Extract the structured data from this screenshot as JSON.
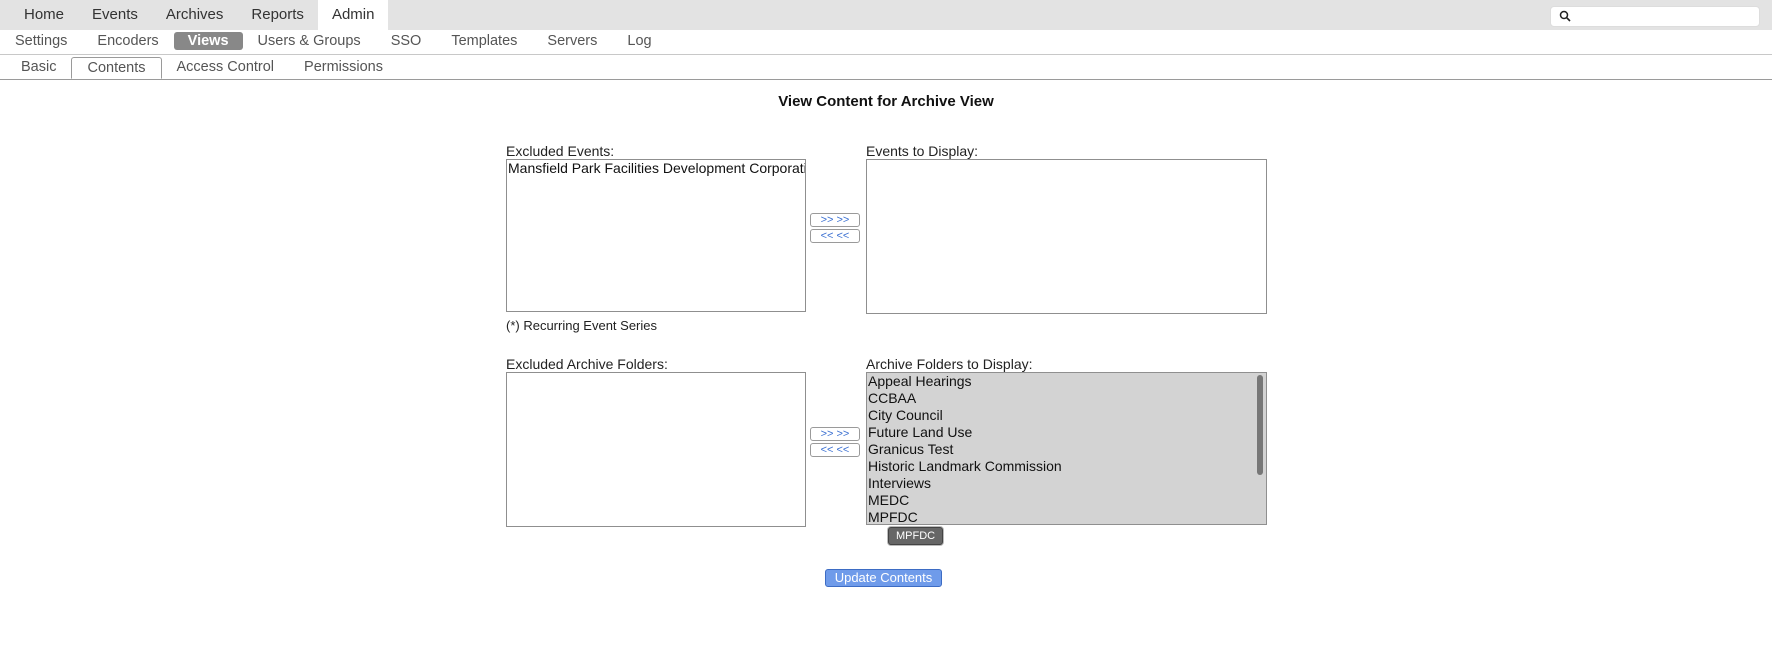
{
  "top_nav": {
    "items": [
      {
        "label": "Home"
      },
      {
        "label": "Events"
      },
      {
        "label": "Archives"
      },
      {
        "label": "Reports"
      },
      {
        "label": "Admin"
      }
    ],
    "active_index": 4
  },
  "search": {
    "value": "",
    "placeholder": ""
  },
  "sub_nav": {
    "items": [
      {
        "label": "Settings"
      },
      {
        "label": "Encoders"
      },
      {
        "label": "Views"
      },
      {
        "label": "Users & Groups"
      },
      {
        "label": "SSO"
      },
      {
        "label": "Templates"
      },
      {
        "label": "Servers"
      },
      {
        "label": "Log"
      }
    ],
    "active_index": 2
  },
  "tabs": {
    "items": [
      {
        "label": "Basic"
      },
      {
        "label": "Contents"
      },
      {
        "label": "Access Control"
      },
      {
        "label": "Permissions"
      }
    ],
    "active_index": 1
  },
  "page": {
    "title": "View Content for Archive View"
  },
  "events": {
    "excluded_label": "Excluded Events:",
    "excluded_items": [
      "Mansfield Park Facilities Development Corporation"
    ],
    "display_label": "Events to Display:",
    "display_items": [],
    "add_label": ">> >>",
    "remove_label": "<< <<",
    "footnote": "(*) Recurring Event Series"
  },
  "folders": {
    "excluded_label": "Excluded Archive Folders:",
    "excluded_items": [],
    "display_label": "Archive Folders to Display:",
    "display_items": [
      "Appeal Hearings",
      "CCBAA",
      "City Council",
      "Future Land Use",
      "Granicus Test",
      "Historic Landmark Commission",
      "Interviews",
      "MEDC",
      "MPFDC"
    ],
    "add_label": ">> >>",
    "remove_label": "<< <<"
  },
  "tooltip": {
    "text": "MPFDC"
  },
  "update_button": {
    "label": "Update Contents"
  },
  "colors": {
    "topbar_bg": "#e3e3e3",
    "active_subnav_bg": "#888888",
    "link_blue": "#3a6fd1",
    "primary_button": "#6f9bea"
  }
}
